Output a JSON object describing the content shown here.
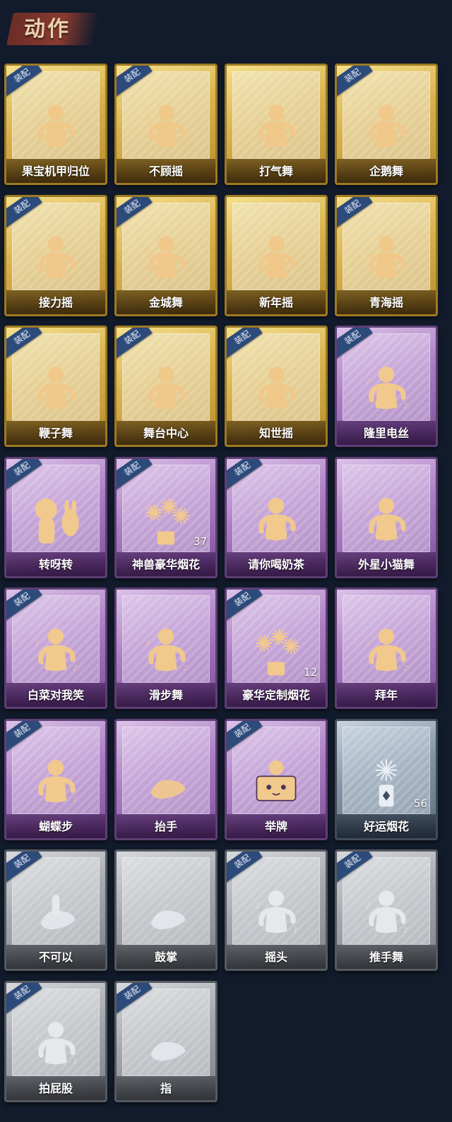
{
  "header": {
    "title": "动作"
  },
  "equip_label": "装配",
  "cards": [
    {
      "label": "果宝机甲归位",
      "tier": "gold",
      "equipped": true,
      "icon": "dancer-icon"
    },
    {
      "label": "不顾摇",
      "tier": "gold",
      "equipped": true,
      "icon": "dancer-icon"
    },
    {
      "label": "打气舞",
      "tier": "gold",
      "equipped": false,
      "icon": "dancer-icon"
    },
    {
      "label": "企鹅舞",
      "tier": "gold",
      "equipped": true,
      "icon": "dancer-icon"
    },
    {
      "label": "接力摇",
      "tier": "gold",
      "equipped": true,
      "icon": "dancer-icon"
    },
    {
      "label": "金城舞",
      "tier": "gold",
      "equipped": true,
      "icon": "dancer-icon"
    },
    {
      "label": "新年摇",
      "tier": "gold",
      "equipped": false,
      "icon": "dancer-icon"
    },
    {
      "label": "青海摇",
      "tier": "gold",
      "equipped": true,
      "icon": "dancer-icon"
    },
    {
      "label": "鞭子舞",
      "tier": "gold",
      "equipped": true,
      "icon": "dancer-icon"
    },
    {
      "label": "舞台中心",
      "tier": "gold",
      "equipped": true,
      "icon": "dancer-icon"
    },
    {
      "label": "知世摇",
      "tier": "gold",
      "equipped": true,
      "icon": "dancer-icon"
    },
    {
      "label": "隆里电丝",
      "tier": "purple",
      "equipped": true,
      "icon": "dancer-icon"
    },
    {
      "label": "转呀转",
      "tier": "purple",
      "equipped": true,
      "icon": "character-icon"
    },
    {
      "label": "神兽豪华烟花",
      "tier": "purple",
      "equipped": true,
      "icon": "fireworks-icon",
      "count": "37"
    },
    {
      "label": "请你喝奶茶",
      "tier": "purple",
      "equipped": true,
      "icon": "dancer-icon"
    },
    {
      "label": "外星小猫舞",
      "tier": "purple",
      "equipped": false,
      "icon": "dancer-icon"
    },
    {
      "label": "白菜对我笑",
      "tier": "purple",
      "equipped": true,
      "icon": "dancer-icon"
    },
    {
      "label": "滑步舞",
      "tier": "purple",
      "equipped": false,
      "icon": "dancer-icon"
    },
    {
      "label": "豪华定制烟花",
      "tier": "purple",
      "equipped": true,
      "icon": "fireworks-icon",
      "count": "12"
    },
    {
      "label": "拜年",
      "tier": "purple",
      "equipped": false,
      "icon": "dancer-icon"
    },
    {
      "label": "蝴蝶步",
      "tier": "purple",
      "equipped": true,
      "icon": "dancer-icon"
    },
    {
      "label": "抬手",
      "tier": "purple",
      "equipped": false,
      "icon": "hand-icon"
    },
    {
      "label": "举牌",
      "tier": "purple",
      "equipped": true,
      "icon": "sign-icon"
    },
    {
      "label": "好运烟花",
      "tier": "blue",
      "equipped": false,
      "icon": "firework-can-icon",
      "count": "56"
    },
    {
      "label": "不可以",
      "tier": "grey",
      "equipped": true,
      "icon": "finger-icon"
    },
    {
      "label": "鼓掌",
      "tier": "grey",
      "equipped": false,
      "icon": "hand-icon"
    },
    {
      "label": "摇头",
      "tier": "grey",
      "equipped": true,
      "icon": "dancer-icon"
    },
    {
      "label": "推手舞",
      "tier": "grey",
      "equipped": true,
      "icon": "dancer-icon"
    },
    {
      "label": "拍屁股",
      "tier": "grey",
      "equipped": true,
      "icon": "dancer-icon"
    },
    {
      "label": "指",
      "tier": "grey",
      "equipped": true,
      "icon": "hand-icon"
    }
  ]
}
